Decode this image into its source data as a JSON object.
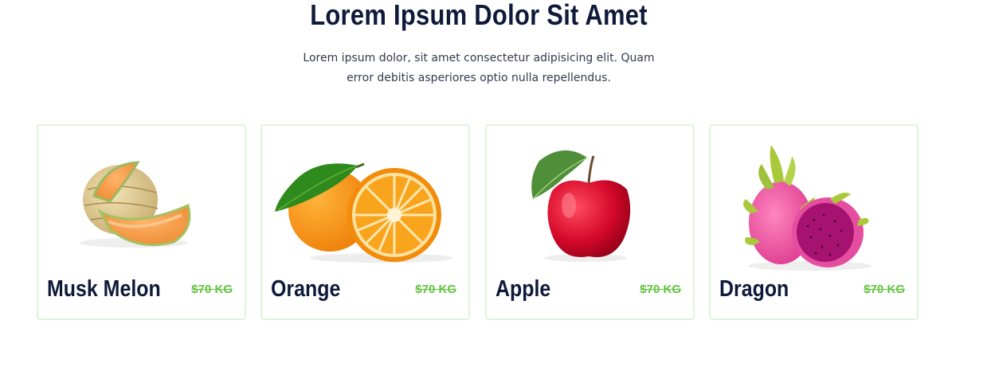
{
  "header": {
    "title": "Lorem Ipsum Dolor Sit Amet",
    "subtitle_line1": "Lorem ipsum dolor, sit amet consectetur adipisicing elit. Quam",
    "subtitle_line2": "error debitis asperiores optio nulla repellendus."
  },
  "products": [
    {
      "name": "Musk Melon",
      "price": "$70 KG",
      "image": "musk-melon-image"
    },
    {
      "name": "Orange",
      "price": "$70 KG",
      "image": "orange-image"
    },
    {
      "name": "Apple",
      "price": "$70 KG",
      "image": "apple-image"
    },
    {
      "name": "Dragon",
      "price": "$70 KG",
      "image": "dragon-fruit-image"
    }
  ],
  "colors": {
    "heading": "#0f1a3a",
    "price": "#5fc43d",
    "card_border": "#dff3dc"
  }
}
